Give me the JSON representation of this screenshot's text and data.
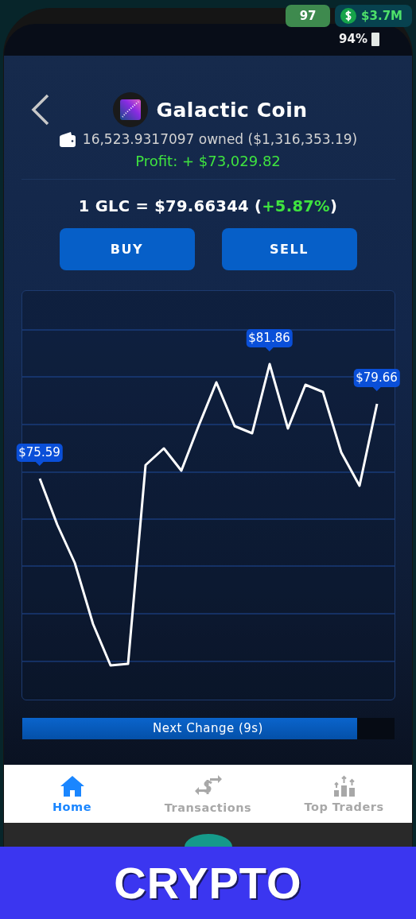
{
  "hud": {
    "level_badge": "97",
    "cash": "$3.7M",
    "battery": "94%"
  },
  "coin": {
    "name": "Galactic Coin",
    "owned": "16,523.9317097 owned ($1,316,353.19)",
    "profit": "Profit: + $73,029.82",
    "rate": "1 GLC = $79.66344 (",
    "change": "+5.87%",
    "rate_end": ")"
  },
  "buttons": [
    "BUY",
    "SELL"
  ],
  "chart": {
    "price_tags": [
      {
        "kind": "first",
        "text": "$75.59"
      },
      {
        "kind": "peak",
        "text": "$81.86"
      },
      {
        "kind": "last",
        "text": "$79.66"
      }
    ]
  },
  "timer": {
    "label": "Next Change (9s)",
    "level": 0.9
  },
  "nav": [
    {
      "kind": "home",
      "label": "Home",
      "selected": true
    },
    {
      "kind": "transactions",
      "label": "Transactions",
      "selected": false
    },
    {
      "kind": "traders",
      "label": "Top Traders",
      "selected": false
    }
  ],
  "banner": "CRYPTO"
}
